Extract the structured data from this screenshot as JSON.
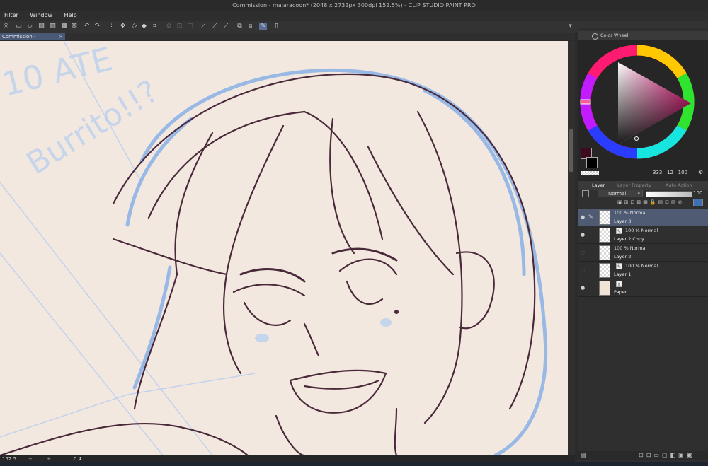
{
  "window": {
    "title": "Commission - majaracoon* (2048 x 2732px 300dpi 152.5%) - CLIP STUDIO PAINT PRO"
  },
  "menu": [
    {
      "label": "Filter"
    },
    {
      "label": "Window"
    },
    {
      "label": "Help"
    }
  ],
  "document_tab": {
    "label": "Commission - majaracoon*",
    "close": "×"
  },
  "canvas": {
    "background": "#f3e8e0",
    "line_color": "#4a2a3a",
    "sketch_color": "#8fb4e6",
    "sketch_text_line1": "10 ATE",
    "sketch_text_line2": "Burrito!!?"
  },
  "status": {
    "zoom": "152.5",
    "rotation": "0.4"
  },
  "color_panel": {
    "tab_label": "Color Wheel",
    "main_color": "#3d0a1f",
    "sub_color": "#000000",
    "readout": "333   12   100"
  },
  "layer_panel": {
    "tabs": [
      "Layer",
      "Layer Property",
      "Auto Action"
    ],
    "blend_mode": "Normal",
    "opacity": "100",
    "layers": [
      {
        "blend": "100 % Normal",
        "name": "Layer 3",
        "selected": true,
        "visible": true,
        "vector": false
      },
      {
        "blend": "100 % Normal",
        "name": "Layer 2 Copy",
        "selected": false,
        "visible": true,
        "vector": true
      },
      {
        "blend": "100 % Normal",
        "name": "Layer 2",
        "selected": false,
        "visible": false,
        "vector": false
      },
      {
        "blend": "100 % Normal",
        "name": "Layer 1",
        "selected": false,
        "visible": false,
        "vector": true
      },
      {
        "blend": "",
        "name": "Paper",
        "selected": false,
        "visible": true,
        "vector": false,
        "paper": true
      }
    ]
  }
}
